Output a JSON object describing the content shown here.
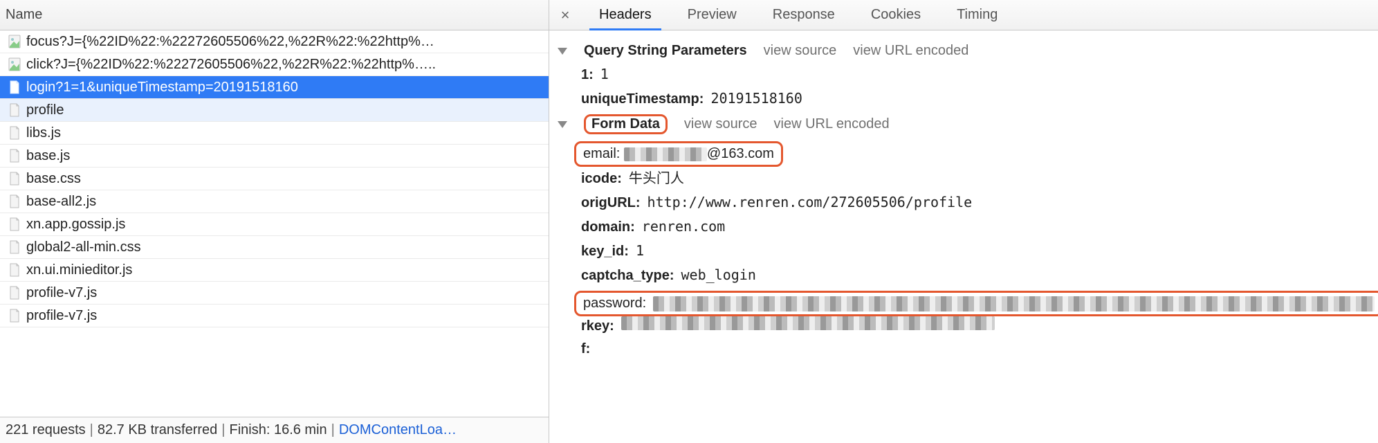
{
  "left": {
    "header": "Name",
    "items": [
      {
        "icon": "image",
        "label": "focus?J={%22ID%22:%22272605506%22,%22R%22:%22http%…",
        "state": "normal"
      },
      {
        "icon": "image",
        "label": "click?J={%22ID%22:%22272605506%22,%22R%22:%22http%…..",
        "state": "normal"
      },
      {
        "icon": "doc",
        "label": "login?1=1&uniqueTimestamp=20191518160",
        "state": "selected"
      },
      {
        "icon": "doc",
        "label": "profile",
        "state": "hovered"
      },
      {
        "icon": "doc",
        "label": "libs.js",
        "state": "normal"
      },
      {
        "icon": "doc",
        "label": "base.js",
        "state": "normal"
      },
      {
        "icon": "doc",
        "label": "base.css",
        "state": "normal"
      },
      {
        "icon": "doc",
        "label": "base-all2.js",
        "state": "normal"
      },
      {
        "icon": "doc",
        "label": "xn.app.gossip.js",
        "state": "normal"
      },
      {
        "icon": "doc",
        "label": "global2-all-min.css",
        "state": "normal"
      },
      {
        "icon": "doc",
        "label": "xn.ui.minieditor.js",
        "state": "normal"
      },
      {
        "icon": "doc",
        "label": "profile-v7.js",
        "state": "normal"
      },
      {
        "icon": "doc",
        "label": "profile-v7.js",
        "state": "normal"
      }
    ]
  },
  "statusbar": {
    "requests": "221 requests",
    "transferred": "82.7 KB transferred",
    "finish": "Finish: 16.6 min",
    "link": "DOMContentLoa…"
  },
  "tabs": {
    "items": [
      "Headers",
      "Preview",
      "Response",
      "Cookies",
      "Timing"
    ],
    "active": 0
  },
  "sections": {
    "qsp": {
      "title": "Query String Parameters",
      "view_source": "view source",
      "view_url_encoded": "view URL encoded",
      "rows": [
        {
          "k": "1:",
          "v": "1"
        },
        {
          "k": "uniqueTimestamp:",
          "v": "20191518160"
        }
      ]
    },
    "form": {
      "title": "Form Data",
      "view_source": "view source",
      "view_url_encoded": "view URL encoded",
      "rows": {
        "email_k": "email:",
        "email_v_suffix": "@163.com",
        "icode_k": "icode:",
        "icode_v": "牛头门人",
        "origURL_k": "origURL:",
        "origURL_v": "http://www.renren.com/272605506/profile",
        "domain_k": "domain:",
        "domain_v": "renren.com",
        "keyid_k": "key_id:",
        "keyid_v": "1",
        "captcha_k": "captcha_type:",
        "captcha_v": "web_login",
        "password_k": "password:",
        "rkey_k": "rkey:",
        "f_k": "f:"
      }
    }
  }
}
